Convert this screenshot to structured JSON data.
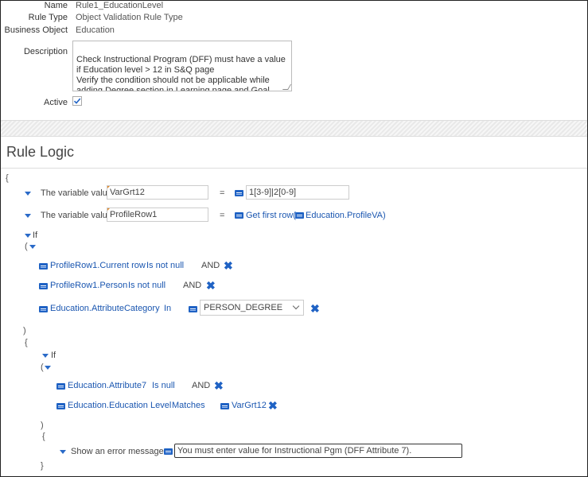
{
  "header": {
    "name_label": "Name",
    "name_value": "Rule1_EducationLevel",
    "rule_type_label": "Rule Type",
    "rule_type_value": "Object Validation Rule Type",
    "business_object_label": "Business Object",
    "business_object_value": "Education",
    "description_label": "Description",
    "description_value": "Check Instructional Program (DFF) must have a value if Education level > 12 in S&Q page\nVerify the condition should not be applicable  while adding Degree section in Learning page and Goal page",
    "active_label": "Active",
    "active_checked": true
  },
  "rule_logic": {
    "title": "Rule Logic",
    "open_brace": "{",
    "close_brace": "}",
    "open_paren": "(",
    "close_paren": ")",
    "var1": {
      "prefix": "The variable value",
      "name": "VarGrt12",
      "op": "=",
      "value": "1[3-9]|2[0-9]"
    },
    "var2": {
      "prefix": "The variable value",
      "name": "ProfileRow1",
      "op": "=",
      "func": "Get first row(",
      "arg": "Education.ProfileVA)"
    },
    "if1": {
      "label": "If",
      "cond1": {
        "field": "ProfileRow1.Current row",
        "op": "Is not null",
        "join": "AND"
      },
      "cond2": {
        "field": "ProfileRow1.Person",
        "op": "Is not null",
        "join": "AND"
      },
      "cond3": {
        "field": "Education.AttributeCategory",
        "op": "In",
        "value": "PERSON_DEGREE"
      }
    },
    "if2": {
      "label": "If",
      "cond1": {
        "field": "Education.Attribute7",
        "op": "Is null",
        "join": "AND"
      },
      "cond2": {
        "field": "Education.Education Level",
        "op": "Matches",
        "value": "VarGrt12"
      }
    },
    "action": {
      "label": "Show an error message",
      "message": "You must enter value for Instructional Pgm (DFF Attribute 7)."
    }
  },
  "colors": {
    "accent": "#1f62c4",
    "corner_marker": "#e08a2e"
  },
  "icons": [
    "check-icon",
    "expand-triangle-icon",
    "expression-icon",
    "delete-x-icon",
    "chevron-down-icon",
    "resize-handle-icon"
  ]
}
